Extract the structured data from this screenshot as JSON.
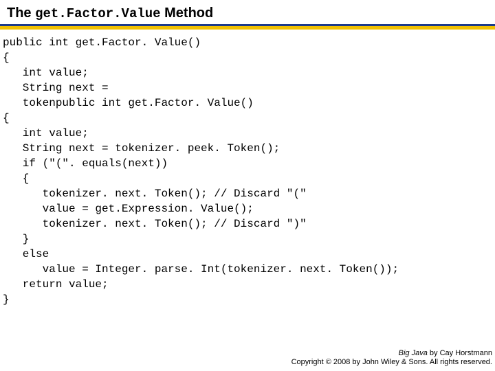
{
  "title": {
    "prefix": "The ",
    "code": "get.Factor.Value",
    "suffix": " Method"
  },
  "code": "public int get.Factor. Value()\n{\n   int value;\n   String next =\n   tokenpublic int get.Factor. Value()\n{\n   int value;\n   String next = tokenizer. peek. Token();\n   if (\"(\". equals(next))\n   {\n      tokenizer. next. Token(); // Discard \"(\"\n      value = get.Expression. Value();\n      tokenizer. next. Token(); // Discard \")\"\n   }\n   else\n      value = Integer. parse. Int(tokenizer. next. Token());\n   return value;\n}",
  "footer": {
    "line1_book": "Big Java",
    "line1_rest": " by Cay Horstmann",
    "line2": "Copyright © 2008 by John Wiley & Sons. All rights reserved."
  }
}
